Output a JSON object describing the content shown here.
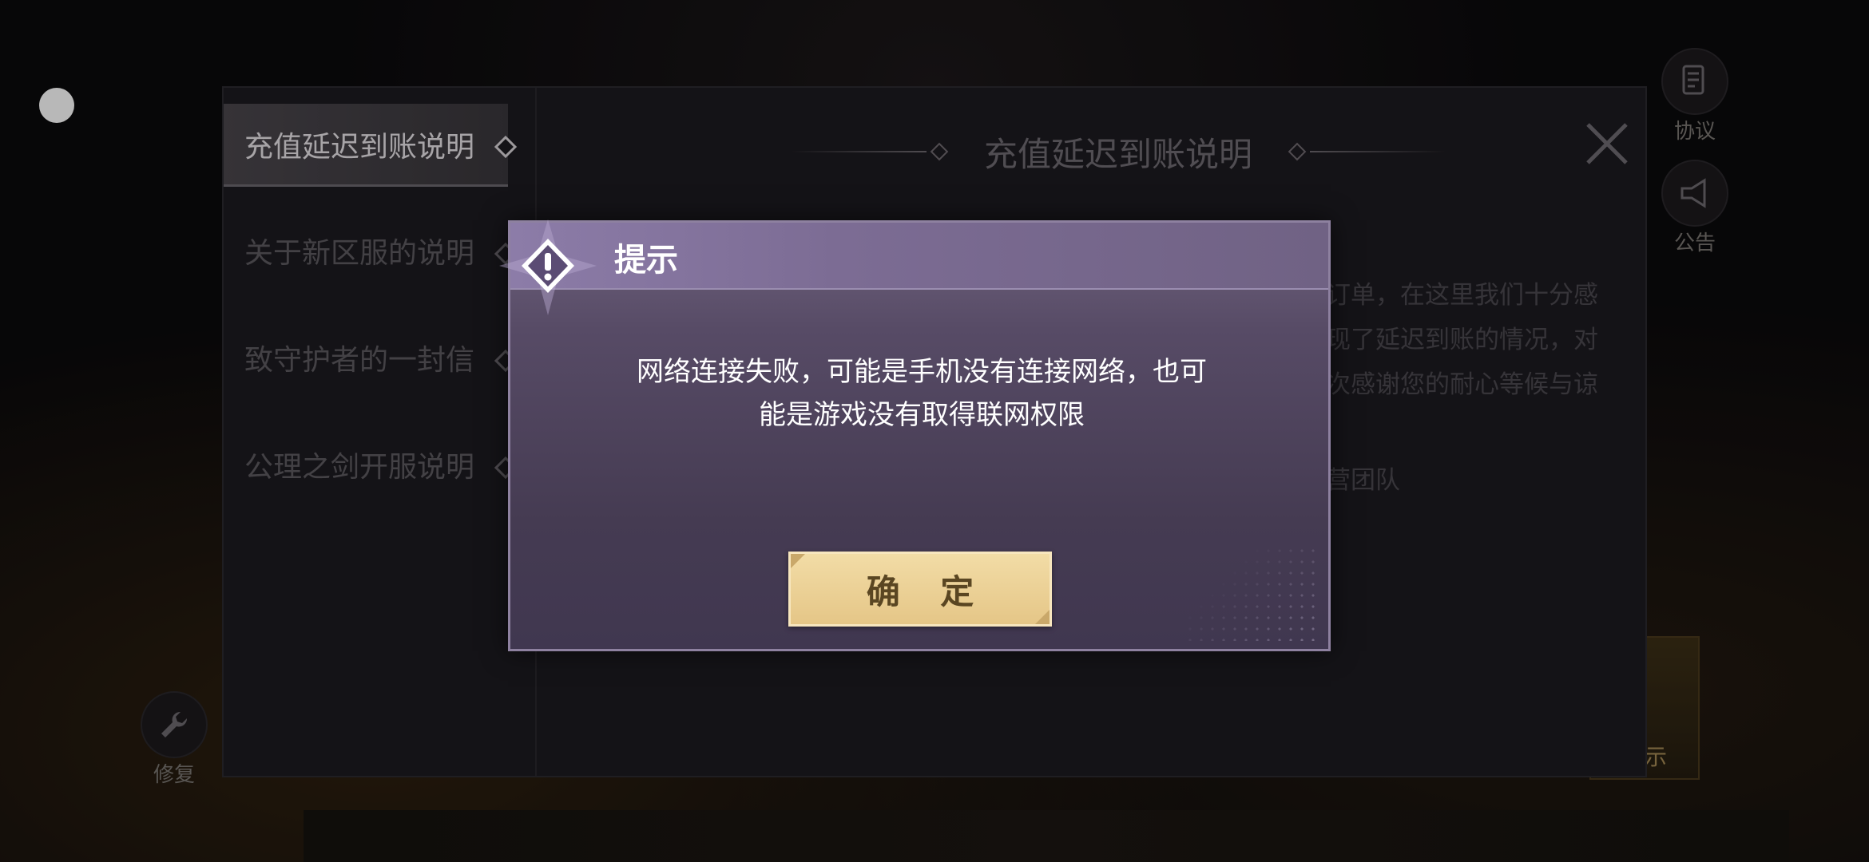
{
  "notice_panel": {
    "sidebar": [
      {
        "label": "充值延迟到账说明",
        "active": true
      },
      {
        "label": "关于新区服的说明",
        "active": false
      },
      {
        "label": "致守护者的一封信",
        "active": false
      },
      {
        "label": "公理之剑开服说明",
        "active": false
      }
    ],
    "title": "充值延迟到账说明",
    "content_peek": [
      "订单，在这里我们十分感",
      "现了延迟到账的情况，对",
      "次感谢您的耐心等候与谅",
      "营团队"
    ]
  },
  "side_buttons": {
    "agreement": "协议",
    "announcement": "公告",
    "repair": "修复",
    "hint": "提示"
  },
  "dialog": {
    "title": "提示",
    "message_line1": "网络连接失败，可能是手机没有连接网络，也可",
    "message_line2": "能是游戏没有取得联网权限",
    "confirm_label": "确 定"
  },
  "colors": {
    "dialog_header": "#8c7ca8",
    "dialog_body": "#453b52",
    "confirm_button": "#efd59c",
    "panel_bg": "#1d1b20"
  }
}
